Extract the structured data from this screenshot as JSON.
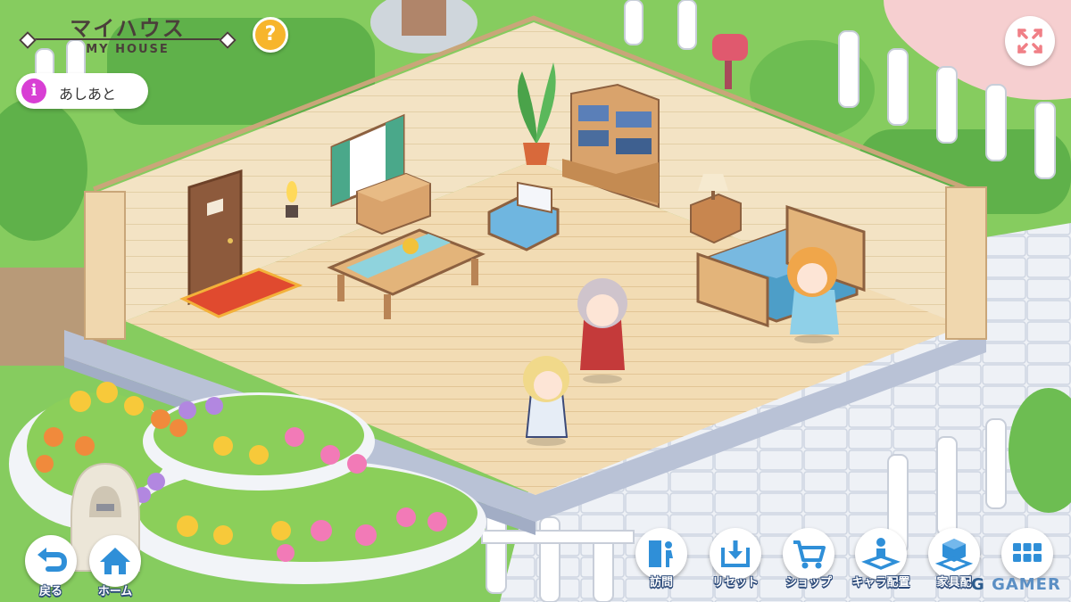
{
  "header": {
    "title": "マイハウス",
    "subtitle": "MY HOUSE",
    "help_symbol": "?"
  },
  "footprints_button": {
    "icon_letter": "i",
    "label": "あしあと"
  },
  "nav_left": [
    {
      "label": "戻る",
      "icon": "return-arrow-icon"
    },
    {
      "label": "ホーム",
      "icon": "house-icon"
    }
  ],
  "nav_right": [
    {
      "label": "訪問",
      "icon": "door-exit-icon"
    },
    {
      "label": "リセット",
      "icon": "reset-download-icon"
    },
    {
      "label": "ショップ",
      "icon": "cart-icon"
    },
    {
      "label": "キャラ配置",
      "icon": "character-place-icon"
    },
    {
      "label": "家具配",
      "icon": "furniture-place-icon"
    },
    {
      "label": "",
      "icon": "grid-menu-icon"
    }
  ],
  "watermark": {
    "prefix": "G",
    "text": "GAMER"
  },
  "colors": {
    "accent_blue": "#2f8fd8",
    "help_yellow": "#f7b52c",
    "info_magenta": "#d83fd4",
    "expand_pink": "#f07f86"
  }
}
